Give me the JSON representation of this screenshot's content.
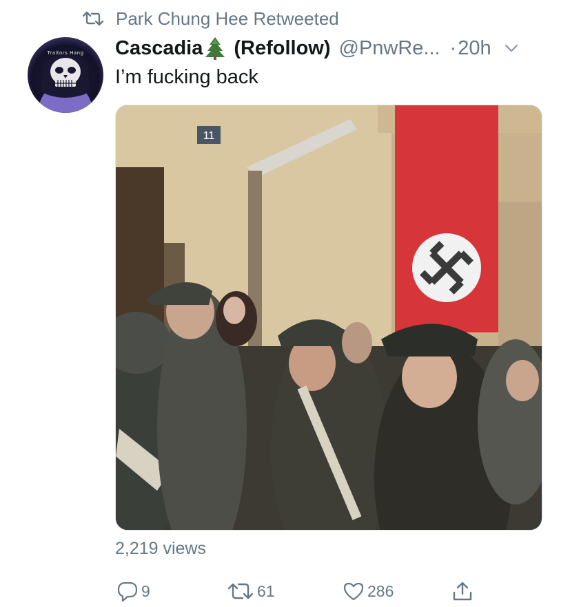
{
  "retweet_context": {
    "icon": "retweet-icon",
    "text": "Park Chung Hee Retweeted"
  },
  "author": {
    "avatar_icon": "skull-avatar",
    "avatar_text": "Traitors Hang",
    "display_name": "Cascadia",
    "emoji_icon": "evergreen-tree-icon",
    "display_name_suffix": "(Refollow)",
    "handle": "@PnwRe...",
    "separator": "·",
    "timestamp": "20h"
  },
  "tweet": {
    "text": "I’m fucking back",
    "media": {
      "type": "video",
      "badge": "11"
    },
    "views": "2,219 views"
  },
  "actions": {
    "reply": {
      "icon": "reply-icon",
      "count": "9"
    },
    "retweet": {
      "icon": "retweet-icon",
      "count": "61"
    },
    "like": {
      "icon": "heart-icon",
      "count": "286"
    },
    "share": {
      "icon": "share-icon"
    }
  },
  "colors": {
    "secondary_text": "#657786",
    "primary_text": "#14171a",
    "background": "#ffffff"
  }
}
